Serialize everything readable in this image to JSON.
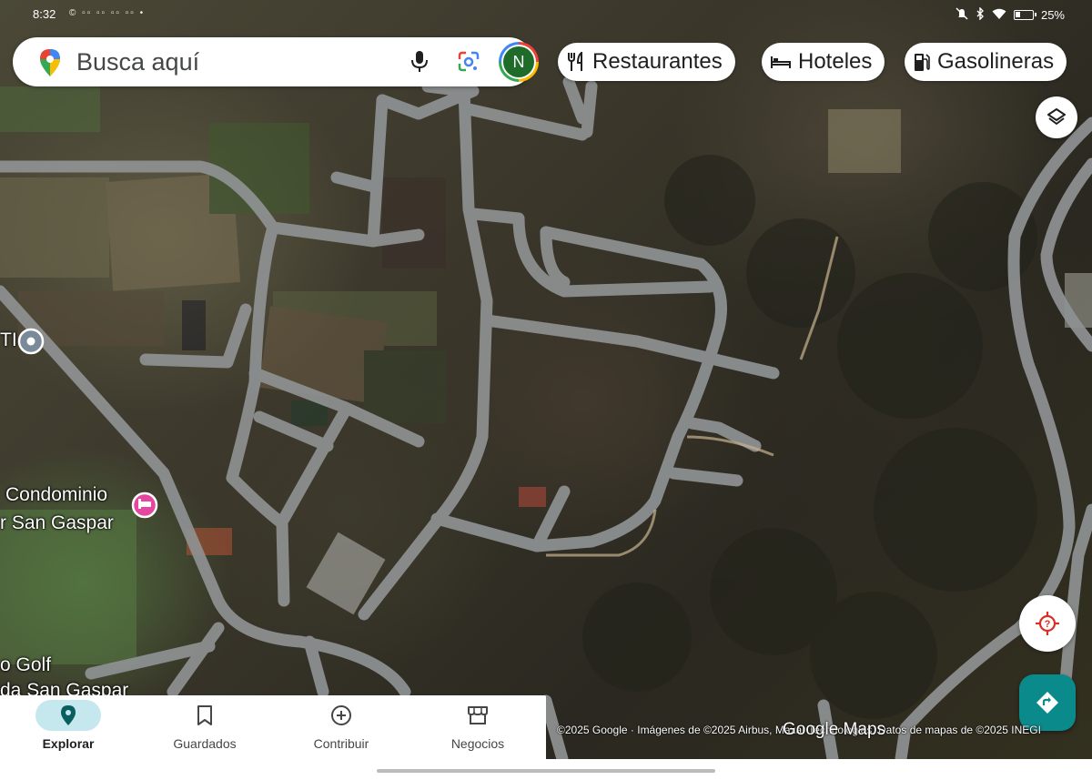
{
  "status_bar": {
    "time": "8:32",
    "left_icons": "© ▫▫ ▫▫ ▫▫ ▫▫ •",
    "battery": "25%"
  },
  "search": {
    "placeholder": "Busca aquí",
    "avatar_initial": "N"
  },
  "chips": [
    {
      "label": "Restaurantes",
      "icon": "fork-knife-icon"
    },
    {
      "label": "Hoteles",
      "icon": "bed-icon"
    },
    {
      "label": "Gasolineras",
      "icon": "gas-pump-icon"
    }
  ],
  "map": {
    "place_labels": {
      "ti": "TI",
      "condominio_line1": "Condominio",
      "condominio_line2": "r San Gaspar",
      "golf_line1": "o Golf",
      "golf_line2": "da San Gaspar"
    },
    "attribution": "©2025 Google · Imágenes de ©2025 Airbus, Maxar Technologies, Datos de mapas de ©2025 INEGI",
    "logo": "Google Maps"
  },
  "bottom_nav": [
    {
      "label": "Explorar",
      "icon": "pin-icon",
      "active": true
    },
    {
      "label": "Guardados",
      "icon": "bookmark-icon",
      "active": false
    },
    {
      "label": "Contribuir",
      "icon": "plus-circle-icon",
      "active": false
    },
    {
      "label": "Negocios",
      "icon": "storefront-icon",
      "active": false
    }
  ],
  "colors": {
    "road": "#8f9293",
    "accent_teal": "#0b8a8c",
    "active_nav_bg": "#c5e7ee",
    "hotel_pin": "#e4479d",
    "poi_pin": "#7b8a98"
  }
}
